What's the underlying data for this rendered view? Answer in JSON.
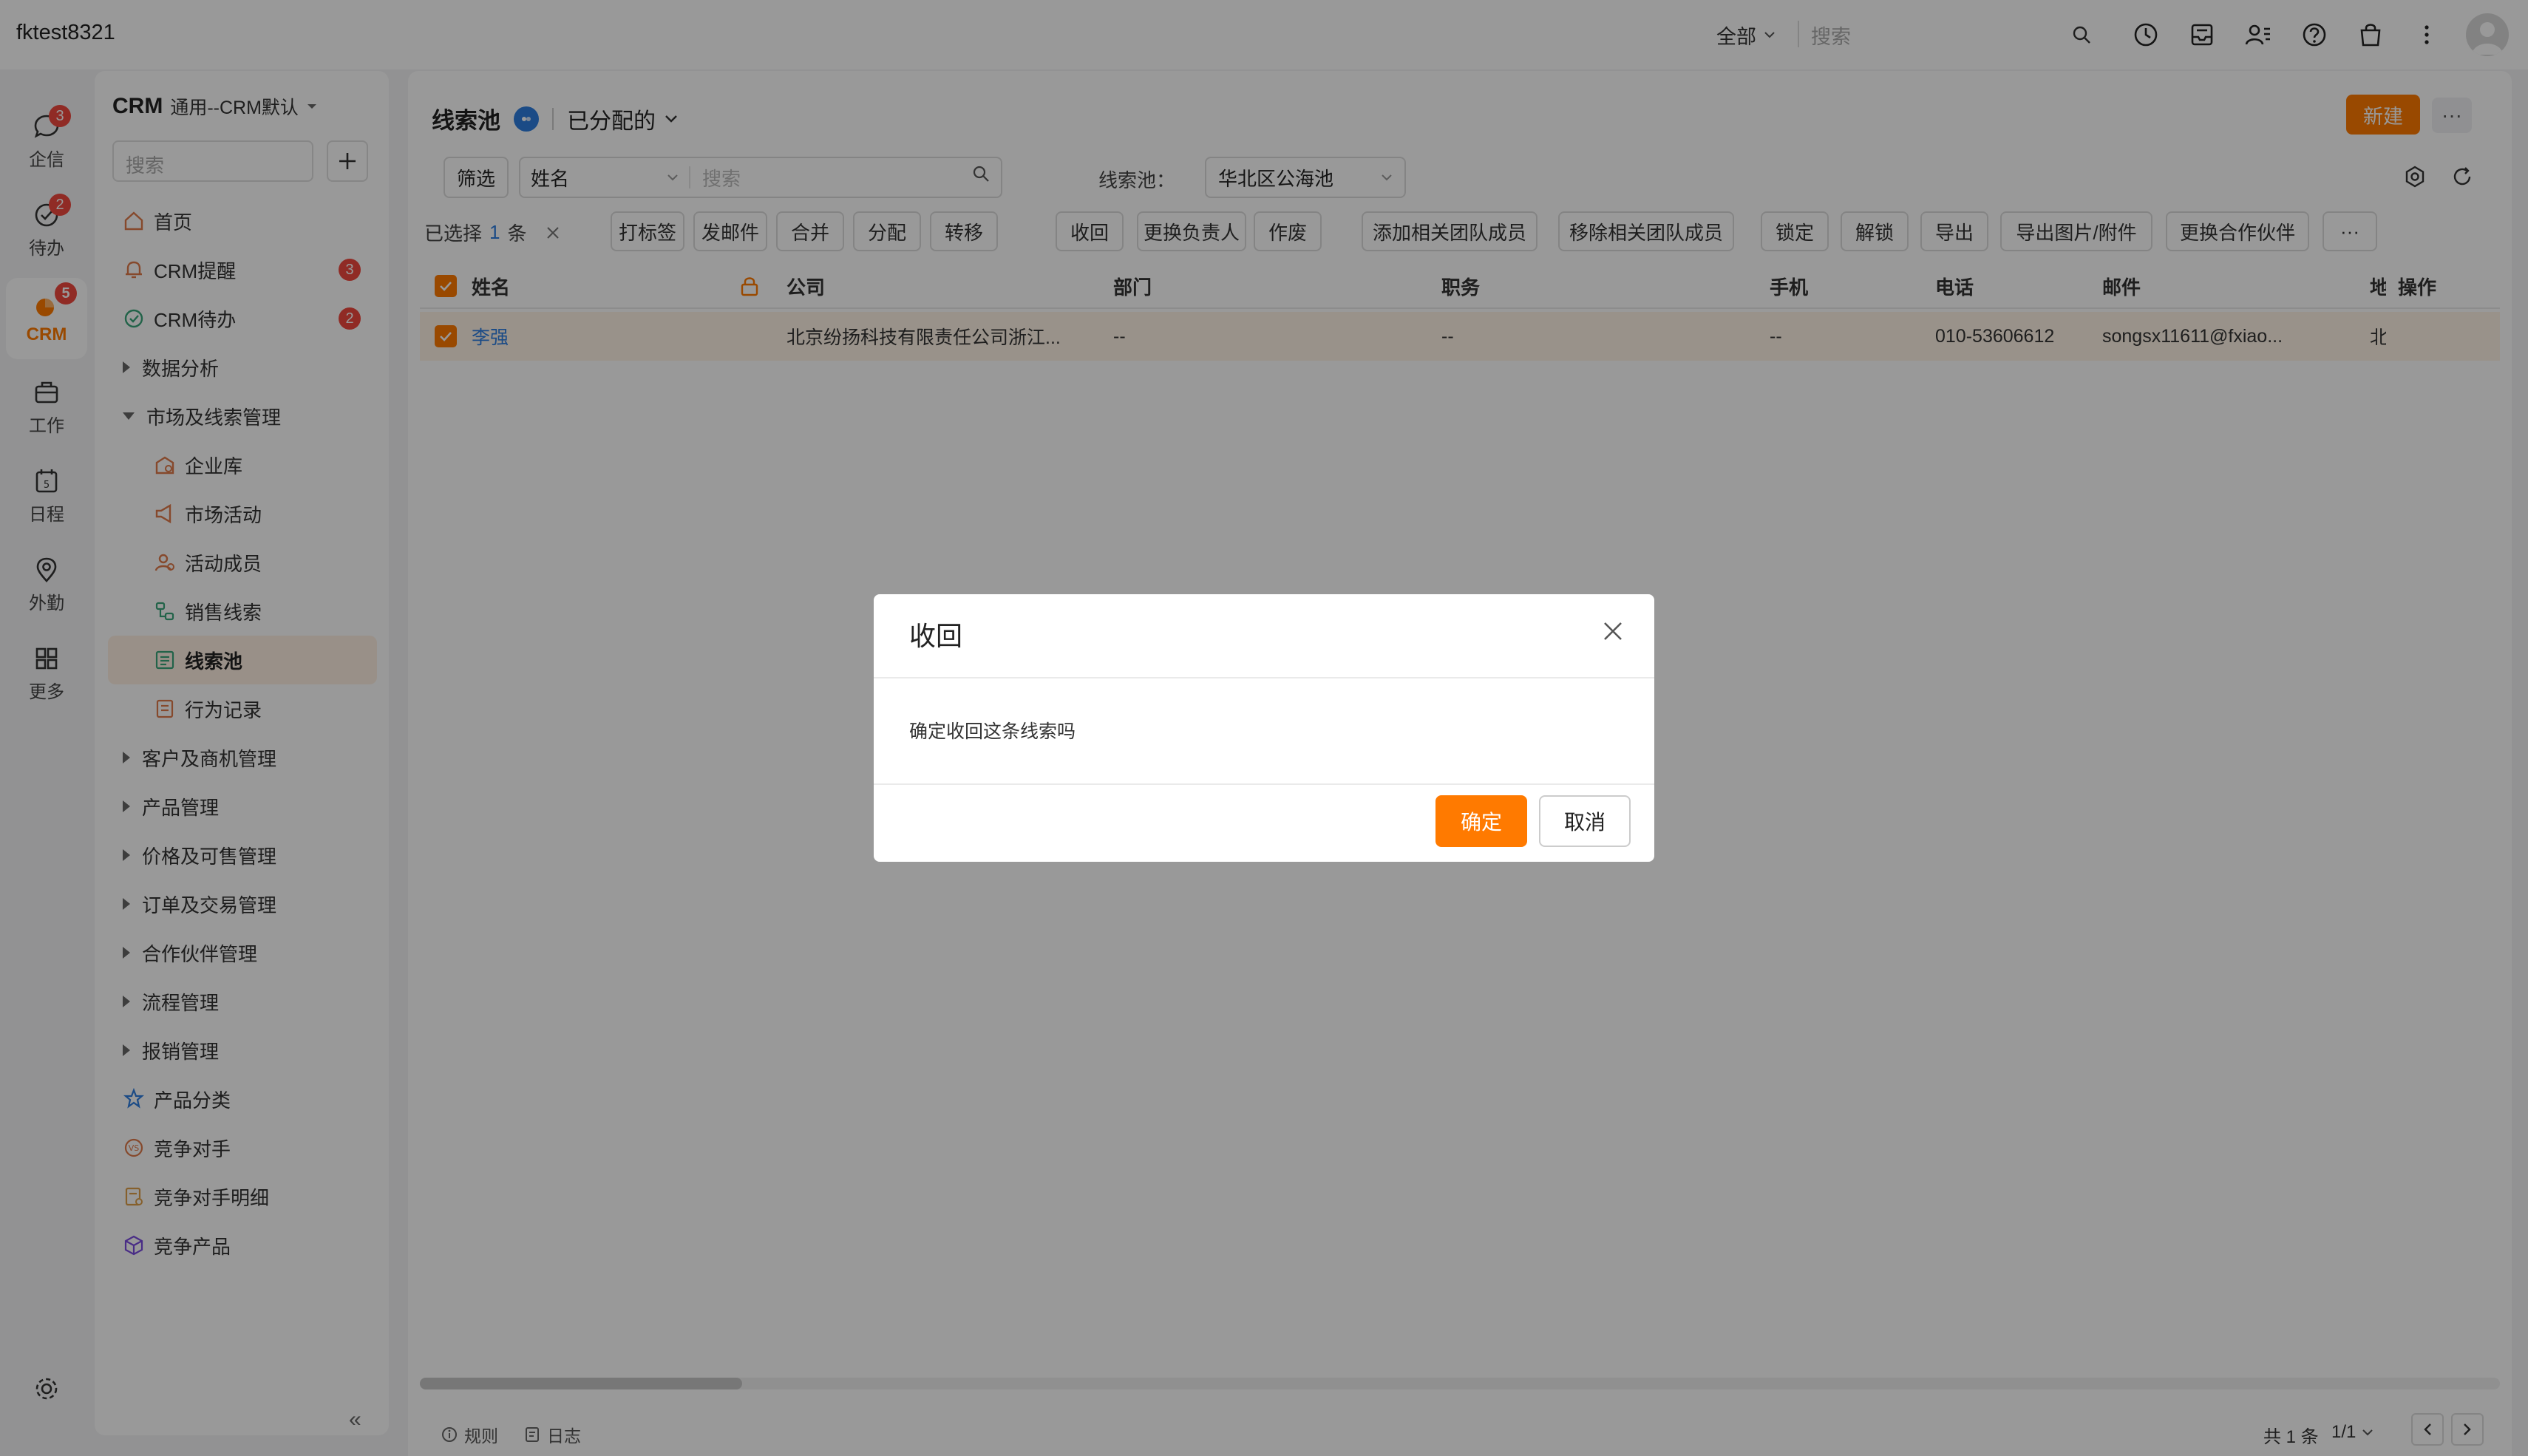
{
  "app": {
    "title": "fktest8321"
  },
  "topbar": {
    "scope": "全部",
    "search_placeholder": "搜索",
    "icons": [
      "clock-icon",
      "inbox-icon",
      "contacts-icon",
      "help-icon",
      "bag-icon",
      "more-vertical-icon"
    ]
  },
  "rail": {
    "items": [
      {
        "label": "企信",
        "icon": "chat-icon",
        "badge": "3"
      },
      {
        "label": "待办",
        "icon": "todo-icon",
        "badge": "2"
      },
      {
        "label": "CRM",
        "icon": "crm-icon",
        "badge": "5"
      },
      {
        "label": "工作",
        "icon": "briefcase-icon",
        "badge": ""
      },
      {
        "label": "日程",
        "icon": "calendar-icon",
        "badge": ""
      },
      {
        "label": "外勤",
        "icon": "location-icon",
        "badge": ""
      },
      {
        "label": "更多",
        "icon": "grid-icon",
        "badge": ""
      }
    ]
  },
  "sidebar": {
    "title": "CRM",
    "subtitle": "通用--CRM默认",
    "search_placeholder": "搜索",
    "items": [
      {
        "label": "首页",
        "icon": "home-icon",
        "badge": ""
      },
      {
        "label": "CRM提醒",
        "icon": "bell-icon",
        "badge": "3"
      },
      {
        "label": "CRM待办",
        "icon": "check-circle-icon",
        "badge": "2"
      },
      {
        "label": "数据分析",
        "icon": "",
        "badge": ""
      },
      {
        "label": "市场及线索管理",
        "icon": "",
        "badge": ""
      },
      {
        "label": "企业库",
        "icon": "building-icon",
        "badge": ""
      },
      {
        "label": "市场活动",
        "icon": "megaphone-icon",
        "badge": ""
      },
      {
        "label": "活动成员",
        "icon": "member-icon",
        "badge": ""
      },
      {
        "label": "销售线索",
        "icon": "leads-icon",
        "badge": ""
      },
      {
        "label": "线索池",
        "icon": "pool-icon",
        "badge": ""
      },
      {
        "label": "行为记录",
        "icon": "record-icon",
        "badge": ""
      },
      {
        "label": "客户及商机管理",
        "icon": "",
        "badge": ""
      },
      {
        "label": "产品管理",
        "icon": "",
        "badge": ""
      },
      {
        "label": "价格及可售管理",
        "icon": "",
        "badge": ""
      },
      {
        "label": "订单及交易管理",
        "icon": "",
        "badge": ""
      },
      {
        "label": "合作伙伴管理",
        "icon": "",
        "badge": ""
      },
      {
        "label": "流程管理",
        "icon": "",
        "badge": ""
      },
      {
        "label": "报销管理",
        "icon": "",
        "badge": ""
      },
      {
        "label": "产品分类",
        "icon": "category-icon",
        "badge": ""
      },
      {
        "label": "竞争对手",
        "icon": "vs-icon",
        "badge": ""
      },
      {
        "label": "竞争对手明细",
        "icon": "detail-icon",
        "badge": ""
      },
      {
        "label": "竞争产品",
        "icon": "cube-icon",
        "badge": ""
      }
    ],
    "collapse_label": "«"
  },
  "main": {
    "title": "线索池",
    "view": "已分配的",
    "new_label": "新建",
    "more_label": "···",
    "filter_label": "筛选",
    "field": "姓名",
    "search_placeholder": "搜索",
    "pool_label": "线索池：",
    "pool_value": "华北区公海池",
    "selection": {
      "prefix": "已选择",
      "count": "1",
      "suffix": "条"
    },
    "actions": [
      "打标签",
      "发邮件",
      "合并",
      "分配",
      "转移",
      "收回",
      "更换负责人",
      "作废",
      "添加相关团队成员",
      "移除相关团队成员",
      "锁定",
      "解锁",
      "导出",
      "导出图片/附件",
      "更换合作伙伴",
      "···"
    ],
    "table": {
      "columns": [
        "姓名",
        "公司",
        "部门",
        "职务",
        "手机",
        "电话",
        "邮件",
        "地",
        "操作"
      ],
      "rows": [
        {
          "name": "李强",
          "company": "北京纷扬科技有限责任公司浙江...",
          "dept": "--",
          "title": "--",
          "mobile": "--",
          "phone": "010-53606612",
          "email": "songsx11611@fxiao...",
          "addr": "北"
        }
      ]
    },
    "footer": {
      "rules": "规则",
      "log": "日志",
      "total": "共 1 条",
      "page": "1/1"
    }
  },
  "modal": {
    "title": "收回",
    "message": "确定收回这条线索吗",
    "ok_label": "确定",
    "cancel_label": "取消"
  },
  "colors": {
    "accent": "#ff7a00",
    "link": "#2d7de0",
    "badge": "#f0483e"
  }
}
